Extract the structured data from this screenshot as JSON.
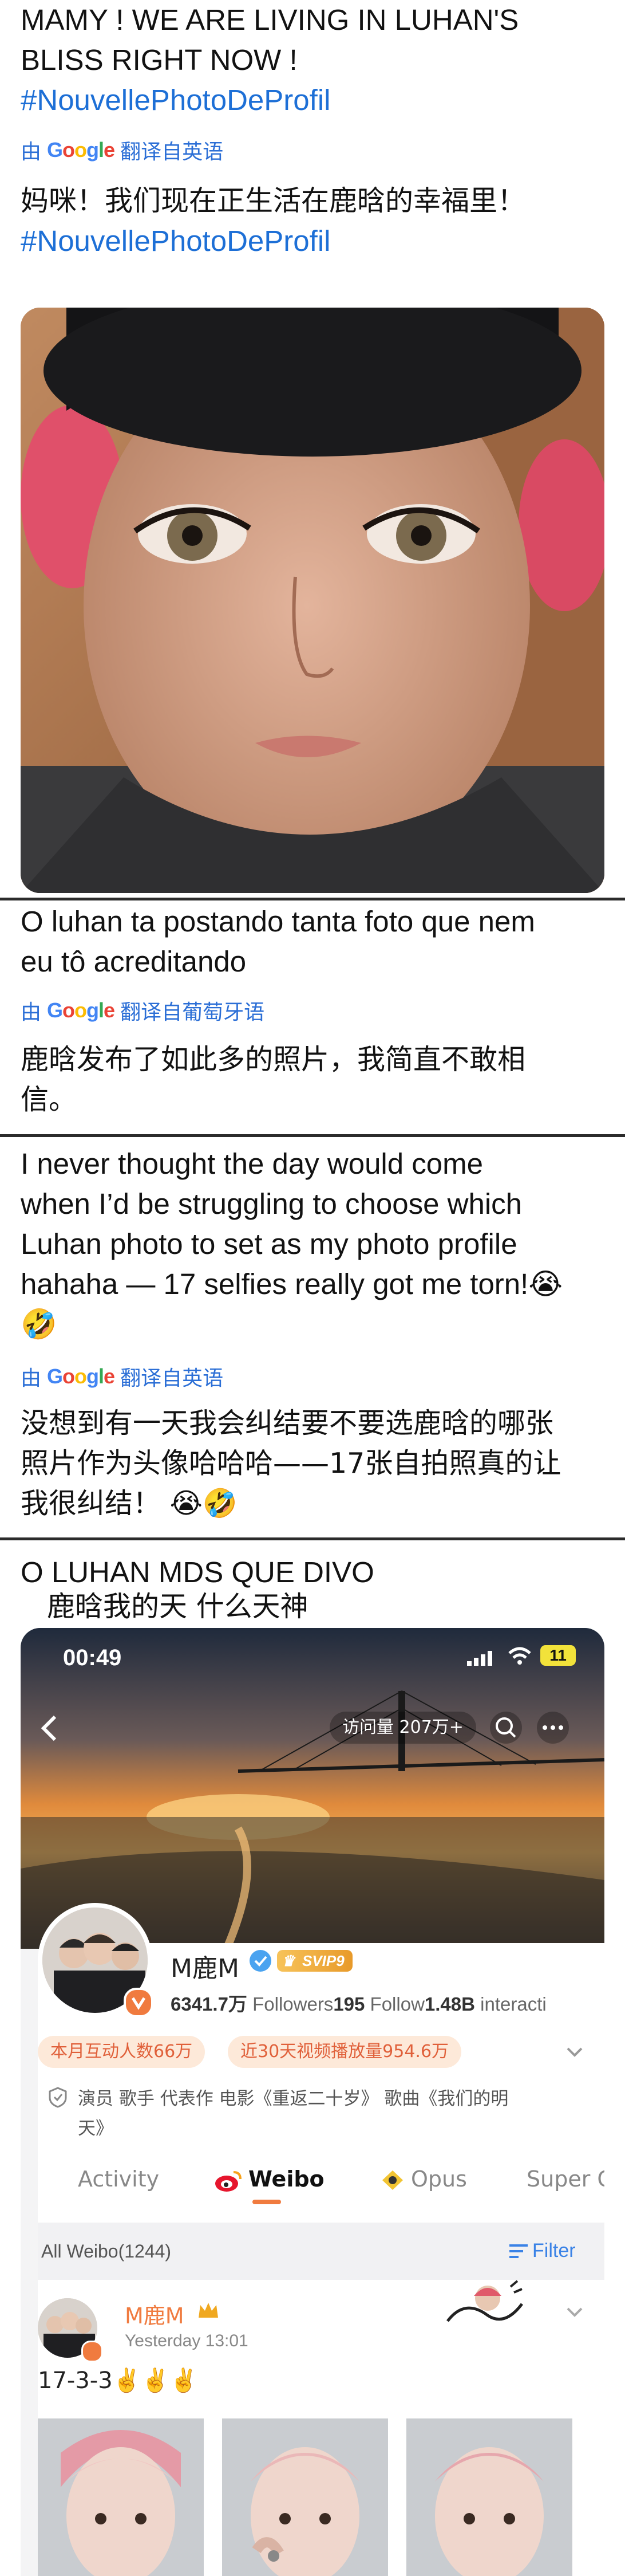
{
  "post1": {
    "text_line1": "MAMY ! WE ARE LIVING IN LUHAN'S",
    "text_line2": "BLISS RIGHT NOW !",
    "hashtag": "#NouvellePhotoDeProfil",
    "translate_by": "由",
    "google": "Google",
    "translate_label": "翻译自英语",
    "translation_line1": "妈咪！我们现在正生活在鹿晗的幸福里！",
    "translation_hashtag": "#NouvellePhotoDeProfil"
  },
  "post2": {
    "text_line1": "O luhan ta postando tanta foto que nem",
    "text_line2": "eu tô acreditando",
    "translate_by": "由",
    "google": "Google",
    "translate_label": "翻译自葡萄牙语",
    "translation_line1": "鹿晗发布了如此多的照片，我简直不敢相",
    "translation_line2": "信。"
  },
  "post3": {
    "text_line1": "I never thought the day would come",
    "text_line2": "when I’d be struggling to choose which",
    "text_line3": "Luhan photo to set as my photo profile",
    "text_line4": "hahaha — 17 selfies really got me torn!😭",
    "text_line5": "🤣",
    "translate_by": "由",
    "google": "Google",
    "translate_label": "翻译自英语",
    "translation_line1": "没想到有一天我会纠结要不要选鹿晗的哪张",
    "translation_line2": "照片作为头像哈哈哈——17张自拍照真的让",
    "translation_line3": "我很纠结！ 😭🤣"
  },
  "post4": {
    "text_line1": "O LUHAN MDS QUE DIVO",
    "text_line2": "鹿晗我的天 什么天神"
  },
  "weibo": {
    "status_time": "00:49",
    "battery": "11",
    "visits": "访问量 207万+",
    "profile_name": "M鹿M",
    "svip": "SVIP9",
    "followers_count": "6341.7万",
    "followers_label": "Followers",
    "follow_count": "195",
    "follow_label": "Follow",
    "interactions_count": "1.48B",
    "interactions_label": "interacti",
    "chip1": "本月互动人数66万",
    "chip2": "近30天视频播放量954.6万",
    "bio_line1": "演员 歌手 代表作 电影《重返二十岁》 歌曲《我们的明",
    "bio_line2": "天》",
    "tabs": [
      "Activity",
      "Weibo",
      "Opus",
      "Super C"
    ],
    "all_weibo": "All Weibo(1244)",
    "filter": "Filter",
    "post_author": "M鹿M",
    "post_time": "Yesterday 13:01",
    "post_text": "17-3-3✌️✌️✌️"
  },
  "colors": {
    "hashtag": "#1d6fd6",
    "translate_link": "#2c6fd6",
    "weibo_orange": "#f07b3f",
    "chip_bg": "#fde9d9"
  }
}
